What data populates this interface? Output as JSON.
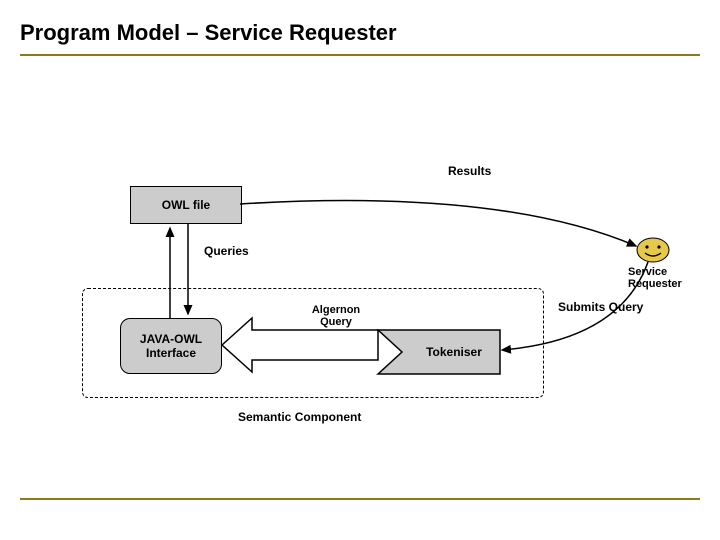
{
  "title": "Program Model – Service Requester",
  "labels": {
    "results": "Results",
    "queries": "Queries",
    "submits_query": "Submits Query",
    "algernon_query": "Algernon\nQuery",
    "semantic_component": "Semantic Component"
  },
  "boxes": {
    "owl_file": "OWL file",
    "java_owl_interface": "JAVA-OWL\nInterface",
    "tokeniser": "Tokeniser"
  },
  "actor": {
    "service_requester": "Service\nRequester"
  },
  "colors": {
    "accent": "#8a7a1a",
    "fill": "#cccccc",
    "face": "#e6c84b"
  }
}
